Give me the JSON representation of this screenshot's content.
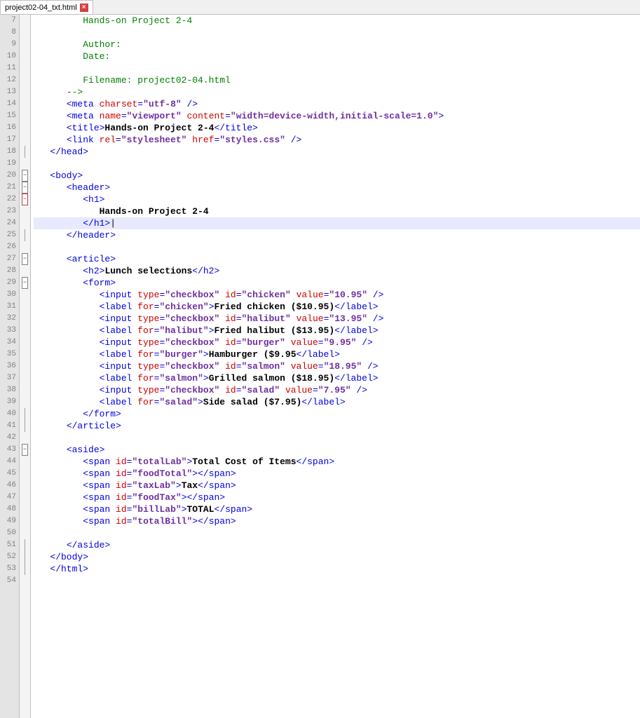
{
  "tab": {
    "label": "project02-04_txt.html",
    "close_glyph": "×"
  },
  "gutter_start": 7,
  "gutter_end": 54,
  "fold": {
    "18": "end",
    "20": "minus",
    "21": "minus",
    "22": "minus-red",
    "25": "end",
    "27": "minus",
    "29": "minus",
    "40": "end",
    "41": "end",
    "43": "minus",
    "51": "end",
    "52": "end",
    "53": "end"
  },
  "lines": [
    {
      "n": 7,
      "i": 3,
      "s": [
        {
          "c": "t-cmt",
          "t": "Hands-on Project 2-4"
        }
      ]
    },
    {
      "n": 8,
      "i": 0,
      "s": []
    },
    {
      "n": 9,
      "i": 3,
      "s": [
        {
          "c": "t-cmt",
          "t": "Author:"
        }
      ]
    },
    {
      "n": 10,
      "i": 3,
      "s": [
        {
          "c": "t-cmt",
          "t": "Date:"
        }
      ]
    },
    {
      "n": 11,
      "i": 0,
      "s": []
    },
    {
      "n": 12,
      "i": 3,
      "s": [
        {
          "c": "t-cmt",
          "t": "Filename: project02-04.html"
        }
      ]
    },
    {
      "n": 13,
      "i": 2,
      "s": [
        {
          "c": "t-cmt",
          "t": "-->"
        }
      ]
    },
    {
      "n": 14,
      "i": 2,
      "s": [
        {
          "c": "t-tag",
          "t": "<meta"
        },
        {
          "c": "",
          "t": " "
        },
        {
          "c": "t-attr",
          "t": "charset"
        },
        {
          "c": "t-tag",
          "t": "="
        },
        {
          "c": "t-val",
          "t": "\"utf-8\""
        },
        {
          "c": "t-tag",
          "t": " />"
        }
      ]
    },
    {
      "n": 15,
      "i": 2,
      "s": [
        {
          "c": "t-tag",
          "t": "<meta"
        },
        {
          "c": "",
          "t": " "
        },
        {
          "c": "t-attr",
          "t": "name"
        },
        {
          "c": "t-tag",
          "t": "="
        },
        {
          "c": "t-val",
          "t": "\"viewport\""
        },
        {
          "c": "",
          "t": " "
        },
        {
          "c": "t-attr",
          "t": "content"
        },
        {
          "c": "t-tag",
          "t": "="
        },
        {
          "c": "t-val",
          "t": "\"width=device-width,initial-scale=1.0\""
        },
        {
          "c": "t-tag",
          "t": ">"
        }
      ]
    },
    {
      "n": 16,
      "i": 2,
      "s": [
        {
          "c": "t-tag",
          "t": "<title>"
        },
        {
          "c": "t-text",
          "t": "Hands-on Project 2-4"
        },
        {
          "c": "t-tag",
          "t": "</title>"
        }
      ]
    },
    {
      "n": 17,
      "i": 2,
      "s": [
        {
          "c": "t-tag",
          "t": "<link"
        },
        {
          "c": "",
          "t": " "
        },
        {
          "c": "t-attr",
          "t": "rel"
        },
        {
          "c": "t-tag",
          "t": "="
        },
        {
          "c": "t-val",
          "t": "\"stylesheet\""
        },
        {
          "c": "",
          "t": " "
        },
        {
          "c": "t-attr",
          "t": "href"
        },
        {
          "c": "t-tag",
          "t": "="
        },
        {
          "c": "t-val",
          "t": "\"styles.css\""
        },
        {
          "c": "t-tag",
          "t": " />"
        }
      ]
    },
    {
      "n": 18,
      "i": 1,
      "s": [
        {
          "c": "t-tag",
          "t": "</head>"
        }
      ]
    },
    {
      "n": 19,
      "i": 0,
      "s": []
    },
    {
      "n": 20,
      "i": 1,
      "s": [
        {
          "c": "t-tag",
          "t": "<body>"
        }
      ]
    },
    {
      "n": 21,
      "i": 2,
      "s": [
        {
          "c": "t-tag",
          "t": "<header>"
        }
      ]
    },
    {
      "n": 22,
      "i": 3,
      "s": [
        {
          "c": "t-tag",
          "t": "<h1>"
        }
      ]
    },
    {
      "n": 23,
      "i": 4,
      "s": [
        {
          "c": "t-text",
          "t": "Hands-on Project 2-4"
        }
      ]
    },
    {
      "n": 24,
      "i": 3,
      "hl": true,
      "s": [
        {
          "c": "t-tag",
          "t": "</h1>"
        },
        {
          "c": "",
          "t": "|"
        }
      ]
    },
    {
      "n": 25,
      "i": 2,
      "s": [
        {
          "c": "t-tag",
          "t": "</header>"
        }
      ]
    },
    {
      "n": 26,
      "i": 0,
      "s": []
    },
    {
      "n": 27,
      "i": 2,
      "s": [
        {
          "c": "t-tag",
          "t": "<article>"
        }
      ]
    },
    {
      "n": 28,
      "i": 3,
      "s": [
        {
          "c": "t-tag",
          "t": "<h2>"
        },
        {
          "c": "t-text",
          "t": "Lunch selections"
        },
        {
          "c": "t-tag",
          "t": "</h2>"
        }
      ]
    },
    {
      "n": 29,
      "i": 3,
      "s": [
        {
          "c": "t-tag",
          "t": "<form>"
        }
      ]
    },
    {
      "n": 30,
      "i": 4,
      "s": [
        {
          "c": "t-tag",
          "t": "<input"
        },
        {
          "c": "",
          "t": " "
        },
        {
          "c": "t-attr",
          "t": "type"
        },
        {
          "c": "t-tag",
          "t": "="
        },
        {
          "c": "t-val",
          "t": "\"checkbox\""
        },
        {
          "c": "",
          "t": " "
        },
        {
          "c": "t-attr",
          "t": "id"
        },
        {
          "c": "t-tag",
          "t": "="
        },
        {
          "c": "t-val",
          "t": "\"chicken\""
        },
        {
          "c": "",
          "t": " "
        },
        {
          "c": "t-attr",
          "t": "value"
        },
        {
          "c": "t-tag",
          "t": "="
        },
        {
          "c": "t-val",
          "t": "\"10.95\""
        },
        {
          "c": "t-tag",
          "t": " />"
        }
      ]
    },
    {
      "n": 31,
      "i": 4,
      "s": [
        {
          "c": "t-tag",
          "t": "<label"
        },
        {
          "c": "",
          "t": " "
        },
        {
          "c": "t-attr",
          "t": "for"
        },
        {
          "c": "t-tag",
          "t": "="
        },
        {
          "c": "t-val",
          "t": "\"chicken\""
        },
        {
          "c": "t-tag",
          "t": ">"
        },
        {
          "c": "t-text",
          "t": "Fried chicken ($10.95)"
        },
        {
          "c": "t-tag",
          "t": "</label>"
        }
      ]
    },
    {
      "n": 32,
      "i": 4,
      "s": [
        {
          "c": "t-tag",
          "t": "<input"
        },
        {
          "c": "",
          "t": " "
        },
        {
          "c": "t-attr",
          "t": "type"
        },
        {
          "c": "t-tag",
          "t": "="
        },
        {
          "c": "t-val",
          "t": "\"checkbox\""
        },
        {
          "c": "",
          "t": " "
        },
        {
          "c": "t-attr",
          "t": "id"
        },
        {
          "c": "t-tag",
          "t": "="
        },
        {
          "c": "t-val",
          "t": "\"halibut\""
        },
        {
          "c": "",
          "t": " "
        },
        {
          "c": "t-attr",
          "t": "value"
        },
        {
          "c": "t-tag",
          "t": "="
        },
        {
          "c": "t-val",
          "t": "\"13.95\""
        },
        {
          "c": "t-tag",
          "t": " />"
        }
      ]
    },
    {
      "n": 33,
      "i": 4,
      "s": [
        {
          "c": "t-tag",
          "t": "<label"
        },
        {
          "c": "",
          "t": " "
        },
        {
          "c": "t-attr",
          "t": "for"
        },
        {
          "c": "t-tag",
          "t": "="
        },
        {
          "c": "t-val",
          "t": "\"halibut\""
        },
        {
          "c": "t-tag",
          "t": ">"
        },
        {
          "c": "t-text",
          "t": "Fried halibut ($13.95)"
        },
        {
          "c": "t-tag",
          "t": "</label>"
        }
      ]
    },
    {
      "n": 34,
      "i": 4,
      "s": [
        {
          "c": "t-tag",
          "t": "<input"
        },
        {
          "c": "",
          "t": " "
        },
        {
          "c": "t-attr",
          "t": "type"
        },
        {
          "c": "t-tag",
          "t": "="
        },
        {
          "c": "t-val",
          "t": "\"checkbox\""
        },
        {
          "c": "",
          "t": " "
        },
        {
          "c": "t-attr",
          "t": "id"
        },
        {
          "c": "t-tag",
          "t": "="
        },
        {
          "c": "t-val",
          "t": "\"burger\""
        },
        {
          "c": "",
          "t": " "
        },
        {
          "c": "t-attr",
          "t": "value"
        },
        {
          "c": "t-tag",
          "t": "="
        },
        {
          "c": "t-val",
          "t": "\"9.95\""
        },
        {
          "c": "t-tag",
          "t": " />"
        }
      ]
    },
    {
      "n": 35,
      "i": 4,
      "s": [
        {
          "c": "t-tag",
          "t": "<label"
        },
        {
          "c": "",
          "t": " "
        },
        {
          "c": "t-attr",
          "t": "for"
        },
        {
          "c": "t-tag",
          "t": "="
        },
        {
          "c": "t-val",
          "t": "\"burger\""
        },
        {
          "c": "t-tag",
          "t": ">"
        },
        {
          "c": "t-text",
          "t": "Hamburger ($9.95"
        },
        {
          "c": "t-tag",
          "t": "</label>"
        }
      ]
    },
    {
      "n": 36,
      "i": 4,
      "s": [
        {
          "c": "t-tag",
          "t": "<input"
        },
        {
          "c": "",
          "t": " "
        },
        {
          "c": "t-attr",
          "t": "type"
        },
        {
          "c": "t-tag",
          "t": "="
        },
        {
          "c": "t-val",
          "t": "\"checkbox\""
        },
        {
          "c": "",
          "t": " "
        },
        {
          "c": "t-attr",
          "t": "id"
        },
        {
          "c": "t-tag",
          "t": "="
        },
        {
          "c": "t-val",
          "t": "\"salmon\""
        },
        {
          "c": "",
          "t": " "
        },
        {
          "c": "t-attr",
          "t": "value"
        },
        {
          "c": "t-tag",
          "t": "="
        },
        {
          "c": "t-val",
          "t": "\"18.95\""
        },
        {
          "c": "t-tag",
          "t": " />"
        }
      ]
    },
    {
      "n": 37,
      "i": 4,
      "s": [
        {
          "c": "t-tag",
          "t": "<label"
        },
        {
          "c": "",
          "t": " "
        },
        {
          "c": "t-attr",
          "t": "for"
        },
        {
          "c": "t-tag",
          "t": "="
        },
        {
          "c": "t-val",
          "t": "\"salmon\""
        },
        {
          "c": "t-tag",
          "t": ">"
        },
        {
          "c": "t-text",
          "t": "Grilled salmon ($18.95)"
        },
        {
          "c": "t-tag",
          "t": "</label>"
        }
      ]
    },
    {
      "n": 38,
      "i": 4,
      "s": [
        {
          "c": "t-tag",
          "t": "<input"
        },
        {
          "c": "",
          "t": " "
        },
        {
          "c": "t-attr",
          "t": "type"
        },
        {
          "c": "t-tag",
          "t": "="
        },
        {
          "c": "t-val",
          "t": "\"checkbox\""
        },
        {
          "c": "",
          "t": " "
        },
        {
          "c": "t-attr",
          "t": "id"
        },
        {
          "c": "t-tag",
          "t": "="
        },
        {
          "c": "t-val",
          "t": "\"salad\""
        },
        {
          "c": "",
          "t": " "
        },
        {
          "c": "t-attr",
          "t": "value"
        },
        {
          "c": "t-tag",
          "t": "="
        },
        {
          "c": "t-val",
          "t": "\"7.95\""
        },
        {
          "c": "t-tag",
          "t": " />"
        }
      ]
    },
    {
      "n": 39,
      "i": 4,
      "s": [
        {
          "c": "t-tag",
          "t": "<label"
        },
        {
          "c": "",
          "t": " "
        },
        {
          "c": "t-attr",
          "t": "for"
        },
        {
          "c": "t-tag",
          "t": "="
        },
        {
          "c": "t-val",
          "t": "\"salad\""
        },
        {
          "c": "t-tag",
          "t": ">"
        },
        {
          "c": "t-text",
          "t": "Side salad ($7.95)"
        },
        {
          "c": "t-tag",
          "t": "</label>"
        }
      ]
    },
    {
      "n": 40,
      "i": 3,
      "s": [
        {
          "c": "t-tag",
          "t": "</form>"
        }
      ]
    },
    {
      "n": 41,
      "i": 2,
      "s": [
        {
          "c": "t-tag",
          "t": "</article>"
        }
      ]
    },
    {
      "n": 42,
      "i": 0,
      "s": []
    },
    {
      "n": 43,
      "i": 2,
      "s": [
        {
          "c": "t-tag",
          "t": "<aside>"
        }
      ]
    },
    {
      "n": 44,
      "i": 3,
      "s": [
        {
          "c": "t-tag",
          "t": "<span"
        },
        {
          "c": "",
          "t": " "
        },
        {
          "c": "t-attr",
          "t": "id"
        },
        {
          "c": "t-tag",
          "t": "="
        },
        {
          "c": "t-val",
          "t": "\"totalLab\""
        },
        {
          "c": "t-tag",
          "t": ">"
        },
        {
          "c": "t-text",
          "t": "Total Cost of Items"
        },
        {
          "c": "t-tag",
          "t": "</span>"
        }
      ]
    },
    {
      "n": 45,
      "i": 3,
      "s": [
        {
          "c": "t-tag",
          "t": "<span"
        },
        {
          "c": "",
          "t": " "
        },
        {
          "c": "t-attr",
          "t": "id"
        },
        {
          "c": "t-tag",
          "t": "="
        },
        {
          "c": "t-val",
          "t": "\"foodTotal\""
        },
        {
          "c": "t-tag",
          "t": "></span>"
        }
      ]
    },
    {
      "n": 46,
      "i": 3,
      "s": [
        {
          "c": "t-tag",
          "t": "<span"
        },
        {
          "c": "",
          "t": " "
        },
        {
          "c": "t-attr",
          "t": "id"
        },
        {
          "c": "t-tag",
          "t": "="
        },
        {
          "c": "t-val",
          "t": "\"taxLab\""
        },
        {
          "c": "t-tag",
          "t": ">"
        },
        {
          "c": "t-text",
          "t": "Tax"
        },
        {
          "c": "t-tag",
          "t": "</span>"
        }
      ]
    },
    {
      "n": 47,
      "i": 3,
      "s": [
        {
          "c": "t-tag",
          "t": "<span"
        },
        {
          "c": "",
          "t": " "
        },
        {
          "c": "t-attr",
          "t": "id"
        },
        {
          "c": "t-tag",
          "t": "="
        },
        {
          "c": "t-val",
          "t": "\"foodTax\""
        },
        {
          "c": "t-tag",
          "t": "></span>"
        }
      ]
    },
    {
      "n": 48,
      "i": 3,
      "s": [
        {
          "c": "t-tag",
          "t": "<span"
        },
        {
          "c": "",
          "t": " "
        },
        {
          "c": "t-attr",
          "t": "id"
        },
        {
          "c": "t-tag",
          "t": "="
        },
        {
          "c": "t-val",
          "t": "\"billLab\""
        },
        {
          "c": "t-tag",
          "t": ">"
        },
        {
          "c": "t-text",
          "t": "TOTAL"
        },
        {
          "c": "t-tag",
          "t": "</span>"
        }
      ]
    },
    {
      "n": 49,
      "i": 3,
      "s": [
        {
          "c": "t-tag",
          "t": "<span"
        },
        {
          "c": "",
          "t": " "
        },
        {
          "c": "t-attr",
          "t": "id"
        },
        {
          "c": "t-tag",
          "t": "="
        },
        {
          "c": "t-val",
          "t": "\"totalBill\""
        },
        {
          "c": "t-tag",
          "t": "></span>"
        }
      ]
    },
    {
      "n": 50,
      "i": 0,
      "s": []
    },
    {
      "n": 51,
      "i": 2,
      "s": [
        {
          "c": "t-tag",
          "t": "</aside>"
        }
      ]
    },
    {
      "n": 52,
      "i": 1,
      "s": [
        {
          "c": "t-tag",
          "t": "</body>"
        }
      ]
    },
    {
      "n": 53,
      "i": 1,
      "s": [
        {
          "c": "t-tag",
          "t": "</html>"
        }
      ]
    },
    {
      "n": 54,
      "i": 0,
      "s": []
    }
  ],
  "indent_unit": "   "
}
